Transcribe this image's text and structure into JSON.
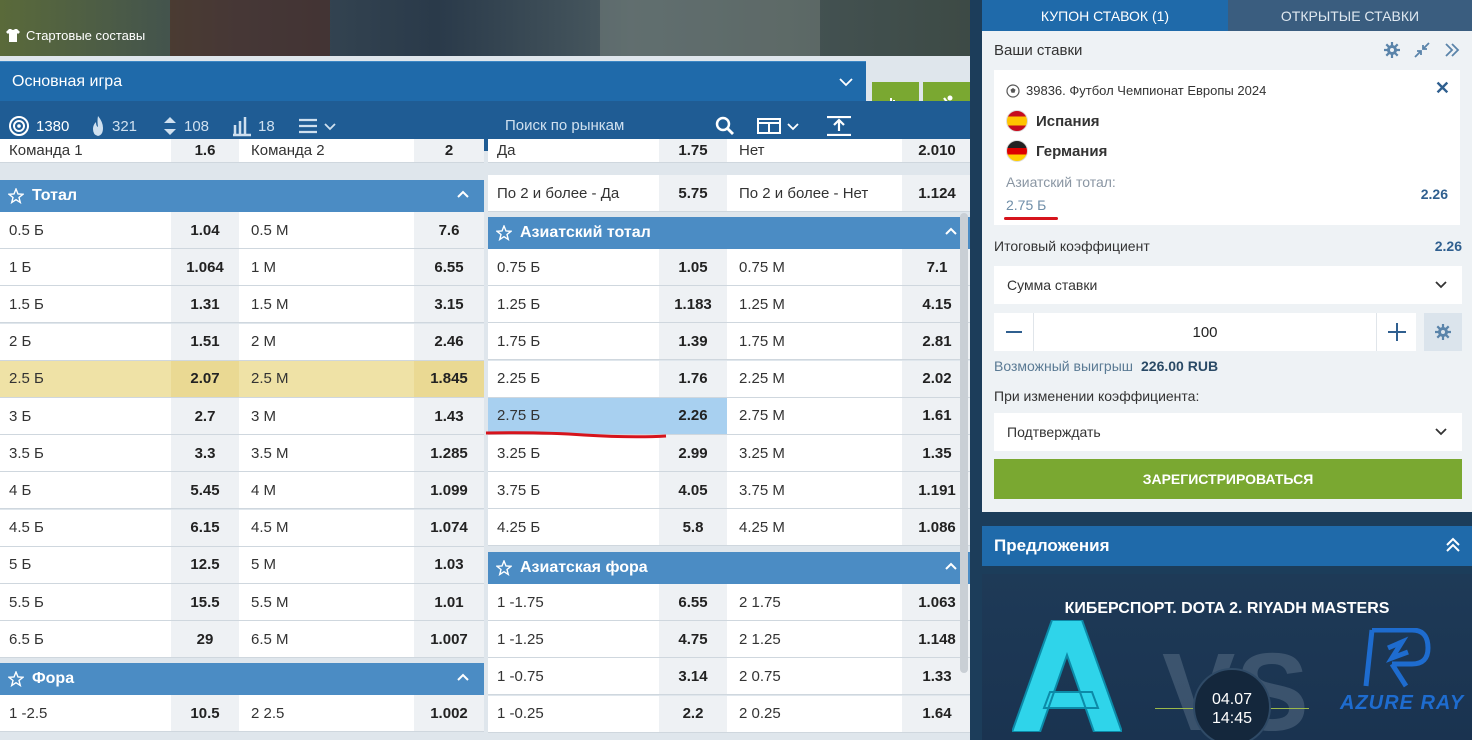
{
  "header": {
    "lineups_label": "Стартовые составы",
    "main_game_label": "Основная игра"
  },
  "filters": {
    "all": "1380",
    "hot": "321",
    "updown": "108",
    "stats": "18",
    "search_placeholder": "Поиск по рынкам"
  },
  "left_col": {
    "partial_top": {
      "c1": "Команда 1",
      "c2": "1.6",
      "c3": "Команда 2",
      "c4": "2"
    },
    "total": {
      "title": "Тотал",
      "rows": [
        {
          "c1": "0.5 Б",
          "c2": "1.04",
          "c3": "0.5 М",
          "c4": "7.6"
        },
        {
          "c1": "1 Б",
          "c2": "1.064",
          "c3": "1 М",
          "c4": "6.55"
        },
        {
          "c1": "1.5 Б",
          "c2": "1.31",
          "c3": "1.5 М",
          "c4": "3.15"
        },
        {
          "c1": "2 Б",
          "c2": "1.51",
          "c3": "2 М",
          "c4": "2.46"
        },
        {
          "c1": "2.5 Б",
          "c2": "2.07",
          "c3": "2.5 М",
          "c4": "1.845"
        },
        {
          "c1": "3 Б",
          "c2": "2.7",
          "c3": "3 М",
          "c4": "1.43"
        },
        {
          "c1": "3.5 Б",
          "c2": "3.3",
          "c3": "3.5 М",
          "c4": "1.285"
        },
        {
          "c1": "4 Б",
          "c2": "5.45",
          "c3": "4 М",
          "c4": "1.099"
        },
        {
          "c1": "4.5 Б",
          "c2": "6.15",
          "c3": "4.5 М",
          "c4": "1.074"
        },
        {
          "c1": "5 Б",
          "c2": "12.5",
          "c3": "5 М",
          "c4": "1.03"
        },
        {
          "c1": "5.5 Б",
          "c2": "15.5",
          "c3": "5.5 М",
          "c4": "1.01"
        },
        {
          "c1": "6.5 Б",
          "c2": "29",
          "c3": "6.5 М",
          "c4": "1.007"
        }
      ]
    },
    "fora": {
      "title": "Фора",
      "rows": [
        {
          "c1": "1 -2.5",
          "c2": "10.5",
          "c3": "2 2.5",
          "c4": "1.002"
        }
      ]
    }
  },
  "right_col": {
    "partial_top": {
      "c1": "Да",
      "c2": "1.75",
      "c3": "Нет",
      "c4": "2.010"
    },
    "both2": {
      "c1": "По 2 и более - Да",
      "c2": "5.75",
      "c3": "По 2 и более - Нет",
      "c4": "1.124"
    },
    "asian_total": {
      "title": "Азиатский тотал",
      "rows": [
        {
          "c1": "0.75 Б",
          "c2": "1.05",
          "c3": "0.75 М",
          "c4": "7.1"
        },
        {
          "c1": "1.25 Б",
          "c2": "1.183",
          "c3": "1.25 М",
          "c4": "4.15"
        },
        {
          "c1": "1.75 Б",
          "c2": "1.39",
          "c3": "1.75 М",
          "c4": "2.81"
        },
        {
          "c1": "2.25 Б",
          "c2": "1.76",
          "c3": "2.25 М",
          "c4": "2.02"
        },
        {
          "c1": "2.75 Б",
          "c2": "2.26",
          "c3": "2.75 М",
          "c4": "1.61"
        },
        {
          "c1": "3.25 Б",
          "c2": "2.99",
          "c3": "3.25 М",
          "c4": "1.35"
        },
        {
          "c1": "3.75 Б",
          "c2": "4.05",
          "c3": "3.75 М",
          "c4": "1.191"
        },
        {
          "c1": "4.25 Б",
          "c2": "5.8",
          "c3": "4.25 М",
          "c4": "1.086"
        }
      ]
    },
    "asian_fora": {
      "title": "Азиатская фора",
      "rows": [
        {
          "c1": "1 -1.75",
          "c2": "6.55",
          "c3": "2 1.75",
          "c4": "1.063"
        },
        {
          "c1": "1 -1.25",
          "c2": "4.75",
          "c3": "2 1.25",
          "c4": "1.148"
        },
        {
          "c1": "1 -0.75",
          "c2": "3.14",
          "c3": "2 0.75",
          "c4": "1.33"
        },
        {
          "c1": "1 -0.25",
          "c2": "2.2",
          "c3": "2 0.25",
          "c4": "1.64"
        }
      ]
    }
  },
  "coupon": {
    "tab_coupon": "КУПОН СТАВОК (1)",
    "tab_open": "ОТКРЫТЫЕ СТАВКИ",
    "your_bets": "Ваши ставки",
    "event": "39836. Футбол Чемпионат Европы 2024",
    "team1": "Испания",
    "team2": "Германия",
    "market_label": "Азиатский тотал:",
    "market_value": "2.75 Б",
    "market_odd": "2.26",
    "total_label": "Итоговый коэффициент",
    "total_odd": "2.26",
    "stake_type": "Сумма ставки",
    "stake_value": "100",
    "possible_win_label": "Возможный выигрыш",
    "possible_win_value": "226.00 RUB",
    "odds_change_label": "При изменении коэффициента:",
    "odds_change_option": "Подтверждать",
    "register_label": "ЗАРЕГИСТРИРОВАТЬСЯ"
  },
  "offers": {
    "title": "Предложения",
    "promo_title": "КИБЕРСПОРТ. DOTA 2. RIYADH MASTERS",
    "date": "04.07",
    "time": "14:45",
    "vs": "VS",
    "team_b": "AZURE RAY"
  },
  "colors": {
    "accent_green": "#7aa831",
    "header_blue": "#1f6aaa",
    "section_blue": "#4b8cc4",
    "highlight_yellow": "#efe2a6",
    "selected_blue": "#a8d0f0",
    "underline_red": "#d6141c"
  }
}
